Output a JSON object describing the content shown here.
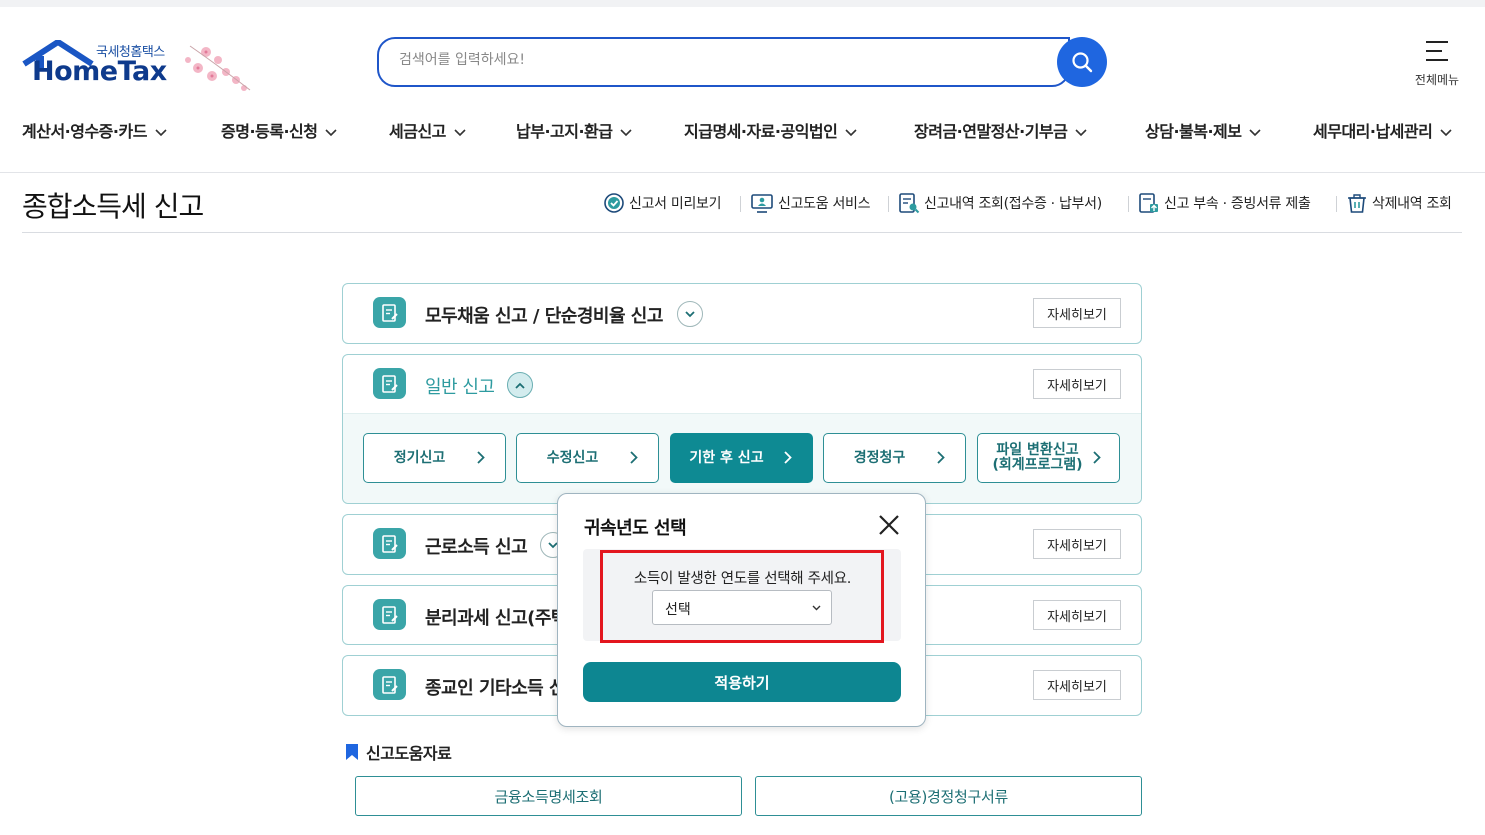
{
  "header": {
    "brand_small": "국세청홈택스",
    "brand": "HomeTax",
    "search_placeholder": "검색어를 입력하세요!",
    "all_menu_label": "전체메뉴"
  },
  "gnb": [
    {
      "label": "계산서·영수증·카드"
    },
    {
      "label": "증명·등록·신청"
    },
    {
      "label": "세금신고"
    },
    {
      "label": "납부·고지·환급"
    },
    {
      "label": "지급명세·자료·공익법인"
    },
    {
      "label": "장려금·연말정산·기부금"
    },
    {
      "label": "상담·불복·제보"
    },
    {
      "label": "세무대리·납세관리"
    }
  ],
  "page": {
    "title": "종합소득세 신고",
    "quick_links": [
      {
        "label": "신고서 미리보기",
        "icon": "check-circle-icon"
      },
      {
        "label": "신고도움 서비스",
        "icon": "monitor-person-icon"
      },
      {
        "label": "신고내역 조회(접수증 · 납부서)",
        "icon": "document-search-icon"
      },
      {
        "label": "신고 부속 · 증빙서류 제출",
        "icon": "document-upload-icon"
      },
      {
        "label": "삭제내역 조회",
        "icon": "trash-icon"
      }
    ]
  },
  "accordion": [
    {
      "title": "모두채움 신고 / 단순경비율 신고",
      "detail_label": "자세히보기",
      "state": "collapsed"
    },
    {
      "title": "일반 신고",
      "detail_label": "자세히보기",
      "state": "expanded",
      "sub_buttons": [
        {
          "label": "정기신고"
        },
        {
          "label": "수정신고"
        },
        {
          "label": "기한 후 신고",
          "active": true
        },
        {
          "label": "경정청구"
        },
        {
          "label": "파일 변환신고 (회계프로그램)"
        }
      ]
    },
    {
      "title": "근로소득 신고",
      "detail_label": "자세히보기",
      "state": "collapsed"
    },
    {
      "title": "분리과세 신고(주택",
      "detail_label": "자세히보기",
      "state": "collapsed"
    },
    {
      "title": "종교인 기타소득 신",
      "detail_label": "자세히보기",
      "state": "collapsed"
    }
  ],
  "modal": {
    "title": "귀속년도 선택",
    "message": "소득이 발생한 연도를 선택해 주세요.",
    "select_value": "선택",
    "apply_label": "적용하기"
  },
  "help": {
    "title": "신고도움자료",
    "buttons": [
      {
        "label": "금융소득명세조회"
      },
      {
        "label": "(고용)경정청구서류"
      }
    ]
  },
  "colors": {
    "brand_blue": "#1f66e0",
    "teal": "#0d8691",
    "highlight_red": "#e3161e"
  }
}
